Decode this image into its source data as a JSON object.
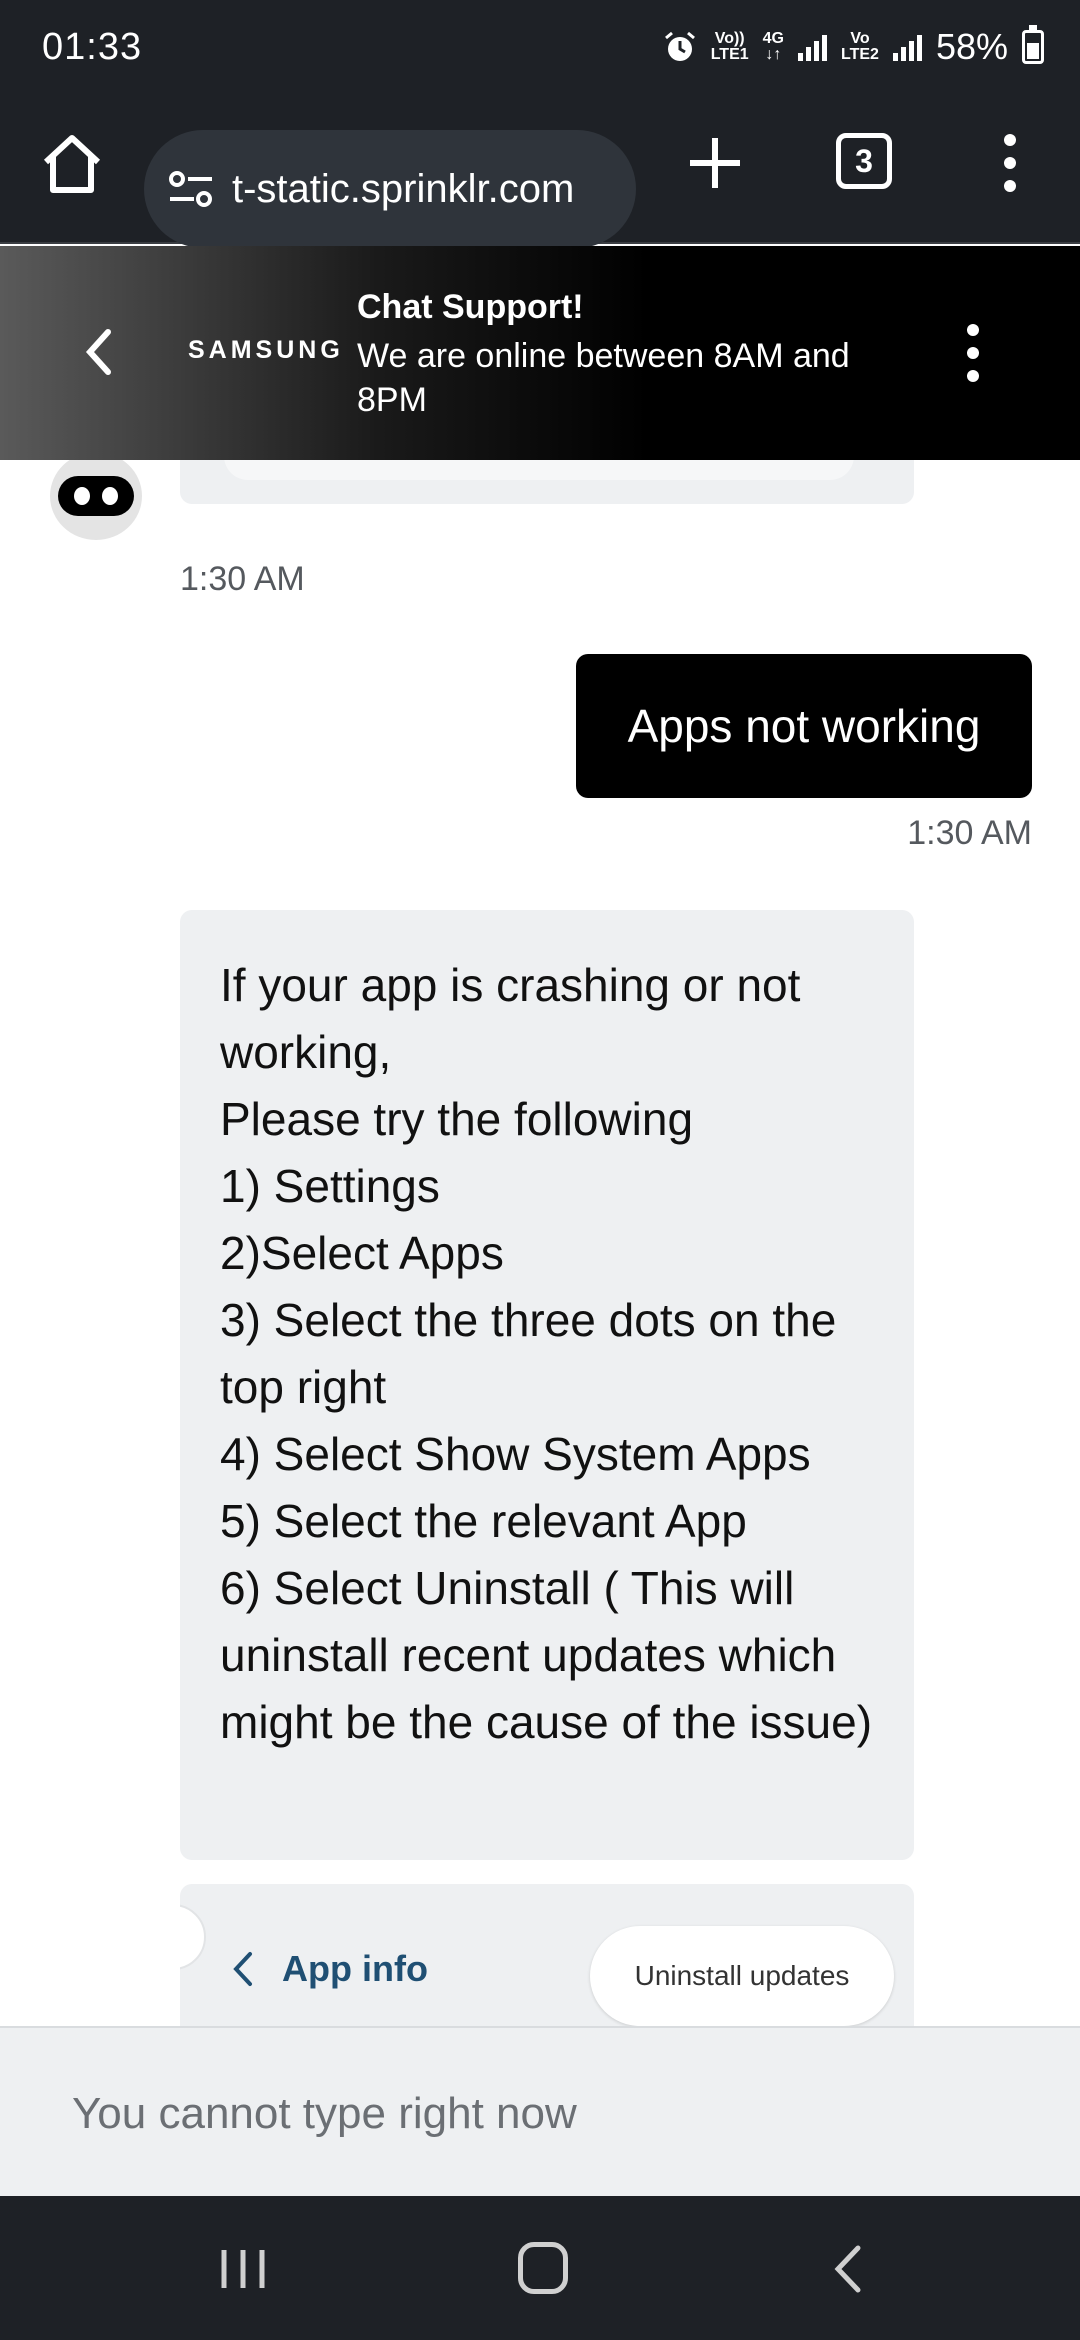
{
  "status_bar": {
    "time": "01:33",
    "network_1_top": "Vo))",
    "network_1_bottom": "LTE1",
    "network_type": "4G",
    "network_2_top": "Vo",
    "network_2_bottom": "LTE2",
    "battery": "58%",
    "icons": [
      "alarm-icon",
      "signal-icon",
      "battery-icon"
    ]
  },
  "browser": {
    "url": "t-static.sprinklr.com",
    "tab_count": "3",
    "icons": [
      "home-icon",
      "site-settings-icon",
      "new-tab-icon",
      "tab-switcher-icon",
      "more-menu-icon"
    ]
  },
  "chat_header": {
    "brand": "SAMSUNG",
    "title": "Chat Support!",
    "subtitle": "We are online between 8AM and 8PM",
    "icons": [
      "back-icon",
      "more-vertical-icon"
    ]
  },
  "messages": [
    {
      "sender": "user",
      "text": "Apps not working",
      "time": "1:30 AM"
    },
    {
      "sender": "bot",
      "text": "If your app is crashing or not working,\nPlease try the following\n1) Settings\n2)Select Apps\n3) Select the three dots on the top right\n4) Select Show System Apps\n5) Select the relevant App\n6) Select Uninstall ( This will uninstall recent updates which might be the cause of the issue)"
    }
  ],
  "previous_time": "1:30 AM",
  "image_card": {
    "label": "App info",
    "button": "Uninstall updates"
  },
  "input": {
    "placeholder": "You cannot type right now"
  },
  "nav": {
    "icons": [
      "recents-icon",
      "home-icon",
      "back-icon"
    ]
  }
}
